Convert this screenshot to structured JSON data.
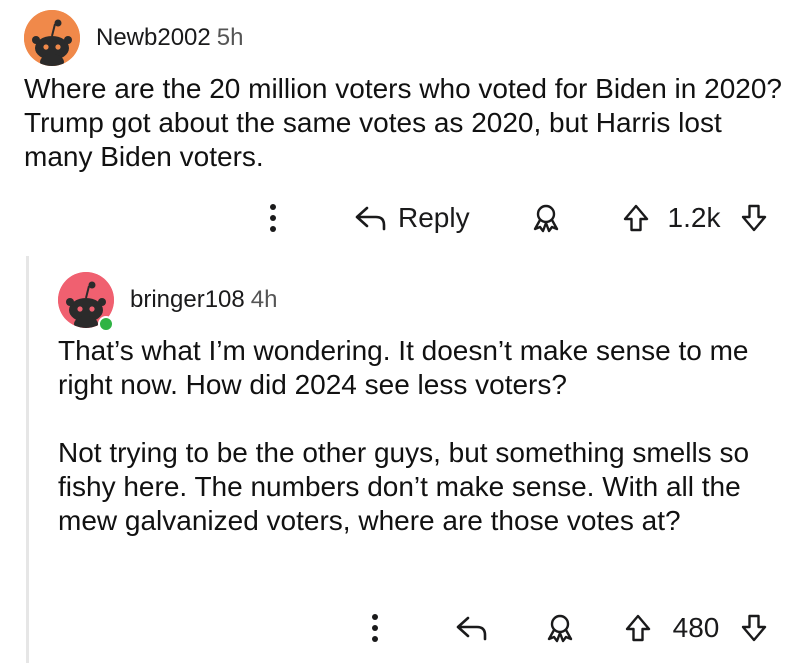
{
  "comments": [
    {
      "username": "Newb2002",
      "age": "5h",
      "body": [
        "Where are the 20 million voters who voted for Biden in 2020? Trump got about the same votes as 2020, but Harris lost many Biden voters."
      ],
      "reply_label": "Reply",
      "score": "1.2k",
      "avatar_color": "#f0894a"
    },
    {
      "username": "bringer108",
      "age": "4h",
      "body": [
        "That’s what I’m wondering. It doesn’t make sense to me right now. How did 2024 see less voters?",
        "Not trying to be the other guys, but something smells so fishy here. The numbers don’t make sense. With all the mew galvanized voters, where are those votes at?"
      ],
      "reply_label": "",
      "score": "480",
      "avatar_color": "#f06070",
      "online_color": "#2fb344"
    }
  ],
  "icons": {
    "more": "more-options-icon",
    "reply": "reply-icon",
    "award": "award-icon",
    "upvote": "upvote-icon",
    "downvote": "downvote-icon"
  }
}
